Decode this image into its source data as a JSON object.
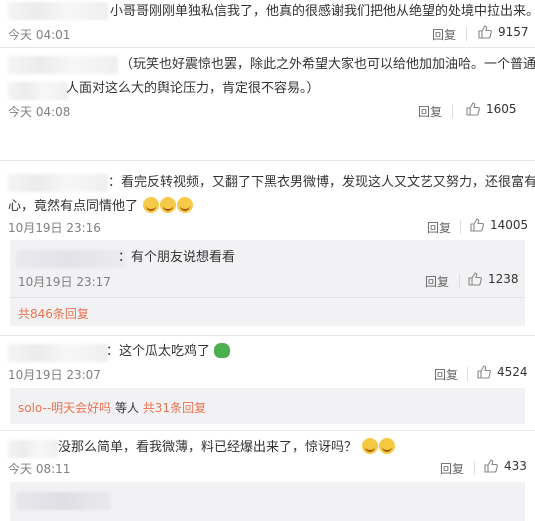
{
  "comments": [
    {
      "text": "小哥哥刚刚单独私信我了，他真的很感谢我们把他从绝望的处境中拉出来。",
      "time": "今天 04:01",
      "reply_label": "回复",
      "likes": "9157"
    },
    {
      "text_line1": "（玩笑也好震惊也罢，除此之外希望大家也可以给他加加油哈。一个普通",
      "text_line2": "人面对这么大的舆论压力，肯定很不容易。）",
      "time": "今天 04:08",
      "reply_label": "回复",
      "likes": "1605"
    },
    {
      "text_line1": "：看完反转视频，又翻了下黑衣男微博，发现这人又文艺又努力，还很富有爱",
      "text_line2": "心，竟然有点同情他了",
      "time": "10月19日 23:16",
      "reply_label": "回复",
      "likes": "14005",
      "sub_reply": {
        "text": "：有个朋友说想看看",
        "time": "10月19日 23:17",
        "reply_label": "回复",
        "likes": "1238"
      },
      "more_replies": "共846条回复"
    },
    {
      "text": "：这个瓜太吃鸡了",
      "time": "10月19日 23:07",
      "reply_label": "回复",
      "likes": "4524",
      "reply_summary": {
        "user": "solo--明天会好吗",
        "mid": " 等人 ",
        "count": "共31条回复"
      }
    },
    {
      "text": "没那么简单，看我微薄，料已经爆出来了，惊讶吗？",
      "time": "今天 08:11",
      "reply_label": "回复",
      "likes": "433"
    }
  ],
  "colors": {
    "link": "#eb7350",
    "meta": "#808080",
    "subbox": "#f2f2f5"
  }
}
